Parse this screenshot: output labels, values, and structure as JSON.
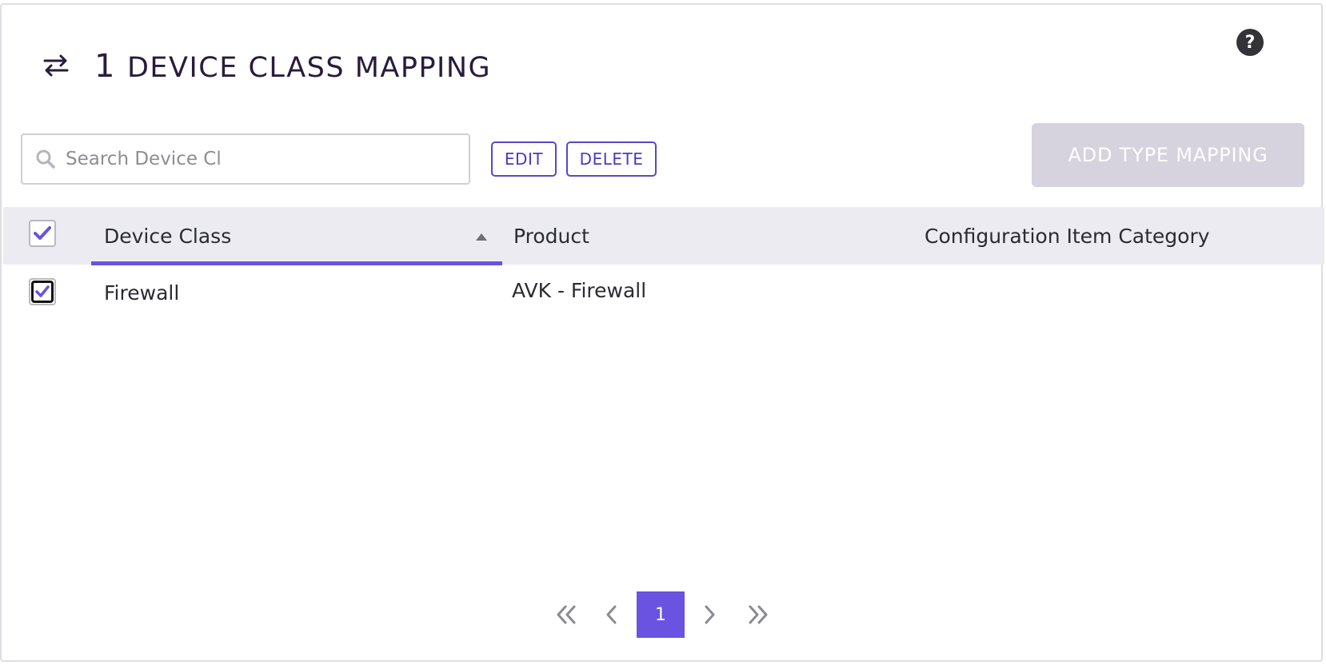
{
  "header": {
    "count": "1",
    "title": "DEVICE CLASS MAPPING",
    "title_icon": "swap-arrows-icon",
    "help_icon": "help-icon"
  },
  "toolbar": {
    "search_placeholder": "Search Device Cl",
    "search_value": "",
    "edit_label": "EDIT",
    "delete_label": "DELETE",
    "add_label": "ADD TYPE MAPPING"
  },
  "table": {
    "columns": [
      "Device Class",
      "Product",
      "Configuration Item Category"
    ],
    "sort": {
      "column": "Device Class",
      "direction": "ascending"
    },
    "select_all_checked": true,
    "rows": [
      {
        "device_class": "Firewall",
        "product": "AVK - Firewall",
        "category": "",
        "checked": true
      }
    ]
  },
  "pagination": {
    "current_page": "1"
  },
  "colors": {
    "accent": "#6a53e0",
    "button_outline": "#5a47c9",
    "disabled_button": "#d6d3df",
    "header_bg": "#ebebf1"
  }
}
